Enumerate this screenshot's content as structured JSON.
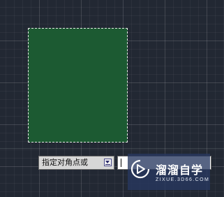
{
  "command_prompt": {
    "label": "指定对角点或",
    "dropdown_icon": "dropdown-arrow-icon",
    "input_value": ""
  },
  "watermark": {
    "title": "溜溜自学",
    "url": "ZIXUE.3D66.COM",
    "icon": "play-logo-icon"
  },
  "colors": {
    "canvas_bg": "#222833",
    "selection_fill": "#1c5a32",
    "selection_border": "#e8e8e8",
    "prompt_bg": "#d7d7d7",
    "watermark_bg": "#283860"
  }
}
